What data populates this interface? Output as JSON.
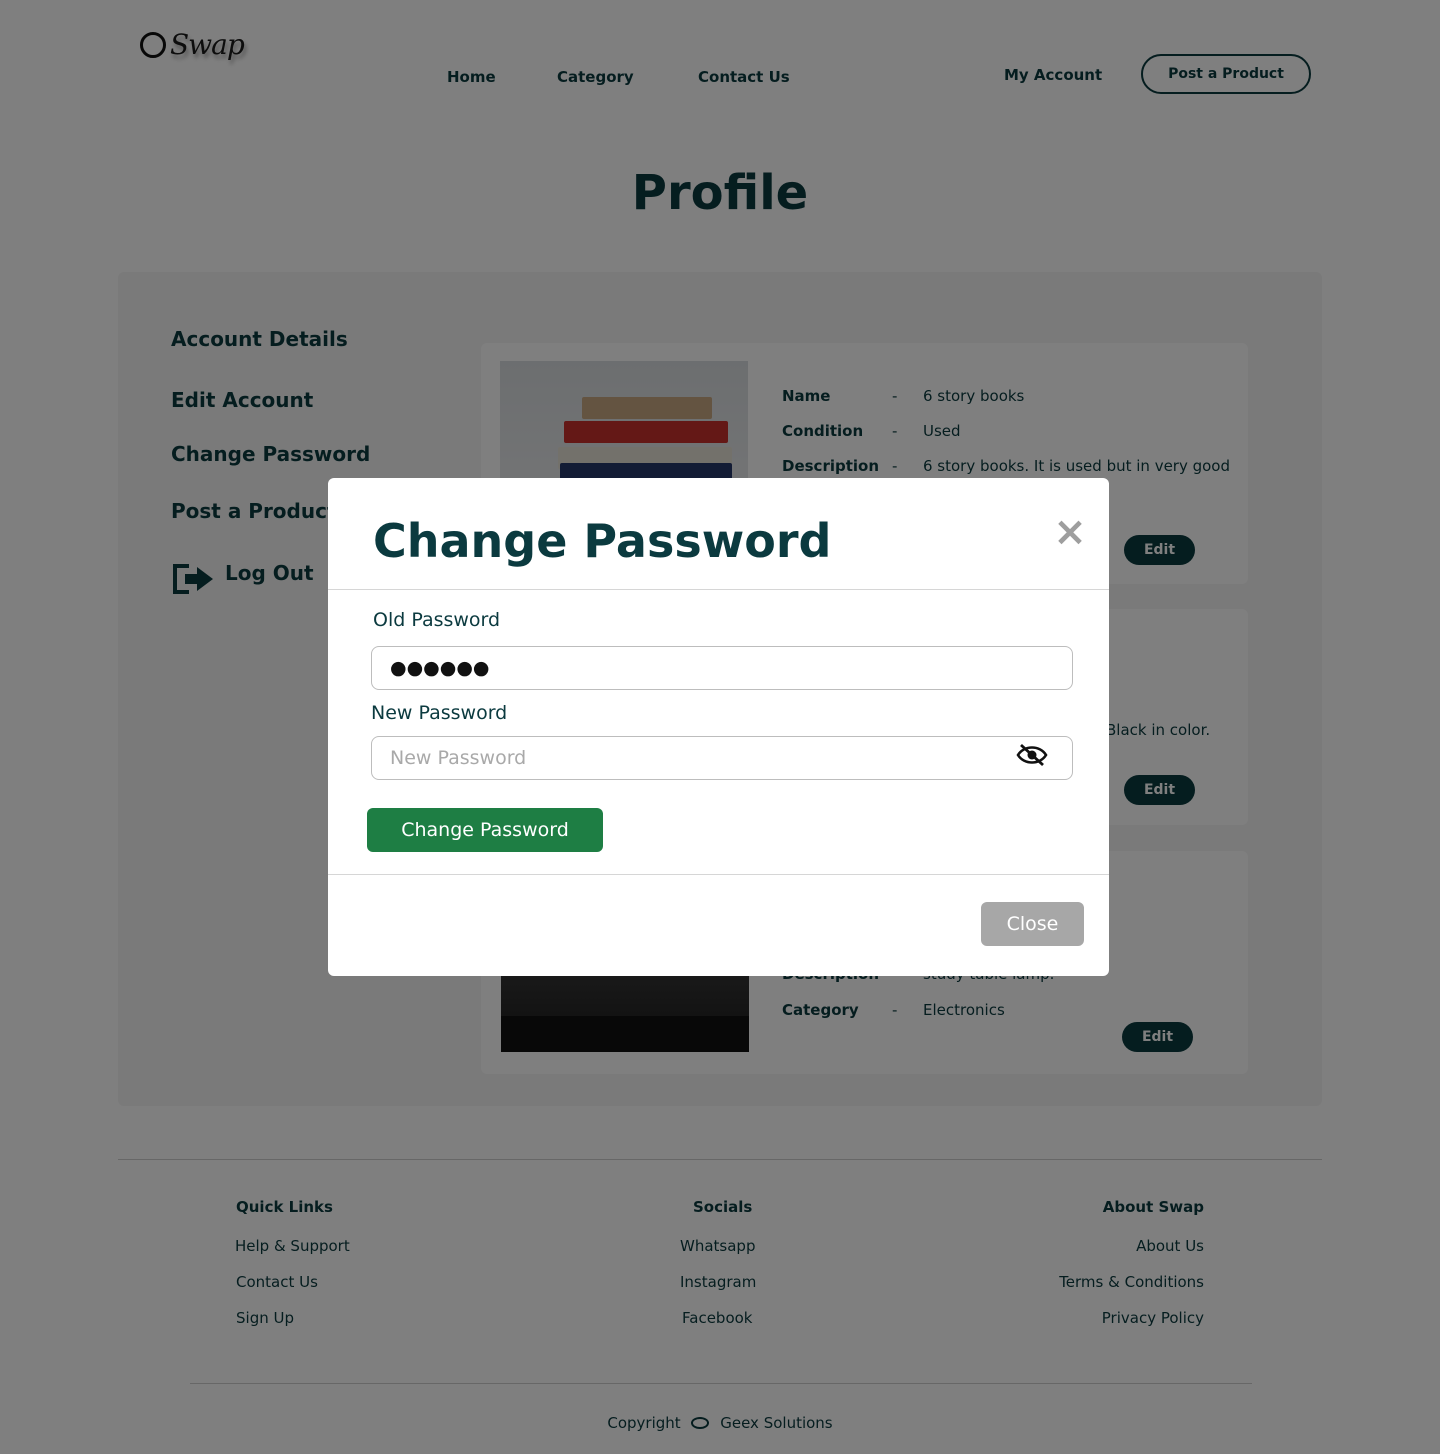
{
  "header": {
    "logo_text": "Swap",
    "nav": [
      "Home",
      "Category",
      "Contact Us"
    ],
    "my_account": "My Account",
    "post_product": "Post a Product"
  },
  "page_title": "Profile",
  "sidebar": {
    "items": [
      "Account Details",
      "Edit Account",
      "Change Password",
      "Post a Product"
    ],
    "logout": "Log Out"
  },
  "products": [
    {
      "fields": [
        {
          "label": "Name",
          "value": "6 story books"
        },
        {
          "label": "Condition",
          "value": "Used"
        },
        {
          "label": "Description",
          "value": "6 story books. It is used but in very good"
        }
      ],
      "edit_label": "Edit"
    },
    {
      "fields": [
        {
          "label": "",
          "value": "Black in color."
        }
      ],
      "edit_label": "Edit"
    },
    {
      "fields": [
        {
          "label": "Description",
          "value": "study table lamp."
        },
        {
          "label": "Category",
          "value": "Electronics"
        }
      ],
      "edit_label": "Edit"
    }
  ],
  "footer": {
    "columns": [
      {
        "heading": "Quick Links",
        "links": [
          "Help & Support",
          "Contact Us",
          "Sign Up"
        ]
      },
      {
        "heading": "Socials",
        "links": [
          "Whatsapp",
          "Instagram",
          "Facebook"
        ]
      },
      {
        "heading": "About Swap",
        "links": [
          "About Us",
          "Terms & Conditions",
          "Privacy Policy"
        ]
      }
    ],
    "copyright_prefix": "Copyright",
    "copyright_owner": "Geex Solutions"
  },
  "modal": {
    "title": "Change Password",
    "close_x": "×",
    "old_password_label": "Old Password",
    "old_password_value": "●●●●●●",
    "new_password_label": "New Password",
    "new_password_placeholder": "New Password",
    "new_password_value": "",
    "submit_label": "Change Password",
    "close_label": "Close",
    "eye_icon": "eye-slash-icon"
  },
  "colors": {
    "primary": "#0b3a3f",
    "submit": "#1e7e44",
    "close_button": "#a7a7a7",
    "overlay": "rgba(0,0,0,0.5)"
  }
}
